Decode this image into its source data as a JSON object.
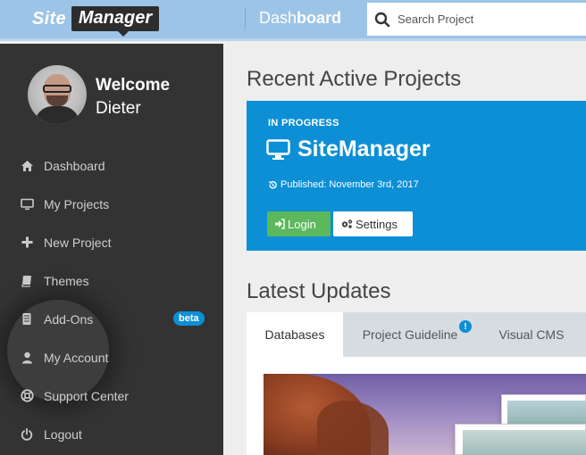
{
  "header": {
    "logo_site": "Site",
    "logo_manager": "Manager",
    "title_light": "Dash",
    "title_bold": "board",
    "search_placeholder": "Search Project"
  },
  "user": {
    "welcome": "Welcome",
    "name": "Dieter"
  },
  "sidebar": {
    "items": [
      {
        "label": "Dashboard",
        "icon": "home-icon"
      },
      {
        "label": "My Projects",
        "icon": "monitor-icon"
      },
      {
        "label": "New Project",
        "icon": "plus-icon"
      },
      {
        "label": "Themes",
        "icon": "book-icon"
      },
      {
        "label": "Add-Ons",
        "icon": "puzzle-icon",
        "badge": "beta"
      },
      {
        "label": "My Account",
        "icon": "user-icon"
      },
      {
        "label": "Support Center",
        "icon": "lifebuoy-icon"
      },
      {
        "label": "Logout",
        "icon": "power-icon"
      }
    ]
  },
  "recent": {
    "title": "Recent Active Projects",
    "project": {
      "status": "IN PROGRESS",
      "name": "SiteManager",
      "published": "Published: November 3rd, 2017",
      "login_label": "Login",
      "settings_label": "Settings"
    }
  },
  "updates": {
    "title": "Latest Updates",
    "tabs": [
      {
        "label": "Databases",
        "active": true
      },
      {
        "label": "Project Guideline",
        "alert": "!"
      },
      {
        "label": "Visual CMS"
      }
    ]
  },
  "colors": {
    "accent": "#0d8fd6",
    "header": "#9cc4e6",
    "sidebar": "#333333",
    "success": "#5cb85c"
  }
}
